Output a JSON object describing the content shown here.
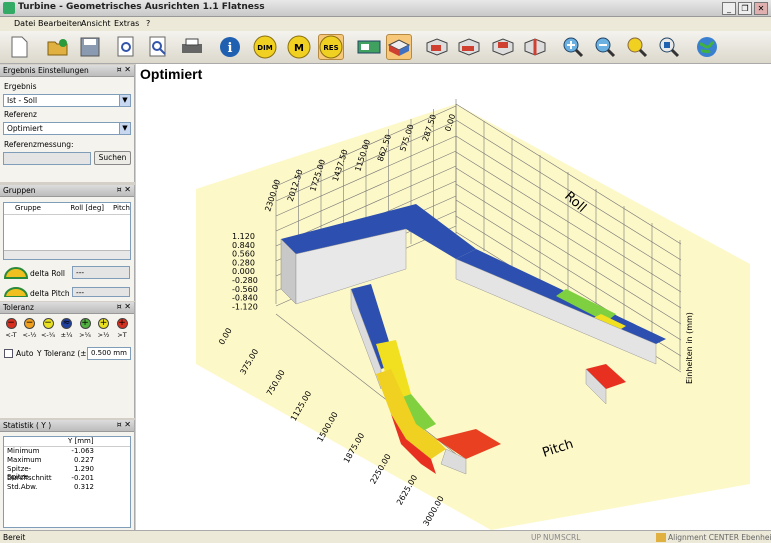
{
  "window": {
    "title": "Turbine - Geometrisches Ausrichten 1.1  Flatness"
  },
  "menu": [
    "Datei",
    "Bearbeiten",
    "Ansicht",
    "Extras",
    "?"
  ],
  "toolbar": {
    "buttons": [
      {
        "name": "new-document-icon",
        "label": ""
      },
      {
        "name": "open-folder-icon",
        "label": ""
      },
      {
        "name": "save-icon",
        "label": ""
      },
      {
        "name": "print-preview-icon",
        "label": ""
      },
      {
        "name": "search-document-icon",
        "label": ""
      },
      {
        "name": "printer-icon",
        "label": ""
      },
      {
        "name": "info-icon",
        "label": ""
      },
      {
        "name": "dim-icon",
        "label": "DIM"
      },
      {
        "name": "measure-m-icon",
        "label": "M"
      },
      {
        "name": "res-icon",
        "label": "RES"
      },
      {
        "name": "device-icon",
        "label": ""
      },
      {
        "name": "view-3d-icon",
        "label": ""
      },
      {
        "name": "view-front-icon",
        "label": ""
      },
      {
        "name": "view-side-icon",
        "label": ""
      },
      {
        "name": "view-top-icon",
        "label": ""
      },
      {
        "name": "view-iso-icon",
        "label": ""
      },
      {
        "name": "zoom-in-icon",
        "label": ""
      },
      {
        "name": "zoom-out-icon",
        "label": ""
      },
      {
        "name": "zoom-fit-icon",
        "label": ""
      },
      {
        "name": "zoom-select-icon",
        "label": ""
      },
      {
        "name": "globe-icon",
        "label": ""
      }
    ]
  },
  "ergebnis": {
    "header": "Ergebnis Einstellungen",
    "ergebnis_label": "Ergebnis",
    "ergebnis_value": "Ist - Soll",
    "referenz_label": "Referenz",
    "referenz_value": "Optimiert",
    "referenzmessung_label": "Referenzmessung:",
    "suchen": "Suchen"
  },
  "gruppen": {
    "header": "Gruppen",
    "columns": [
      "Gruppe",
      "Roll [deg]",
      "Pitch"
    ],
    "delta_roll_label": "delta Roll",
    "delta_roll_value": "---",
    "delta_pitch_label": "delta Pitch",
    "delta_pitch_value": "---"
  },
  "toleranz": {
    "header": "Toleranz",
    "items": [
      {
        "symbol": "−",
        "label": "<-T",
        "color": "#d83020"
      },
      {
        "symbol": "−",
        "label": "<-½",
        "color": "#f0a020"
      },
      {
        "symbol": "−",
        "label": "<-¼",
        "color": "#e8e020"
      },
      {
        "symbol": "≈",
        "label": "±¼",
        "color": "#2040a0"
      },
      {
        "symbol": "+",
        "label": ">¼",
        "color": "#50b040"
      },
      {
        "symbol": "+",
        "label": ">½",
        "color": "#e8e020"
      },
      {
        "symbol": "+",
        "label": ">T",
        "color": "#d83020"
      }
    ],
    "auto_label": "Auto",
    "y_tol_label": "Y Toleranz (±)",
    "y_tol_value": "0.500 mm"
  },
  "statistik": {
    "header": "Statistik ( Y )",
    "col": "Y [mm]",
    "rows": [
      {
        "k": "Minimum",
        "v": "-1.063"
      },
      {
        "k": "Maximum",
        "v": "0.227"
      },
      {
        "k": "Spitze-Spitze",
        "v": "1.290"
      },
      {
        "k": "Durchschnitt",
        "v": "-0.201"
      },
      {
        "k": "Std.Abw.",
        "v": "0.312"
      }
    ]
  },
  "view": {
    "title": "Optimiert",
    "roll_label": "Roll",
    "pitch_label": "Pitch",
    "y_unit_label": "Einheiten in (mm)",
    "roll_ticks": [
      "2300.00",
      "2012.50",
      "1725.00",
      "1437.50",
      "1150.00",
      "862.50",
      "575.00",
      "287.50",
      "0.00"
    ],
    "pitch_ticks": [
      "0.00",
      "375.00",
      "750.00",
      "1125.00",
      "1500.00",
      "1875.00",
      "2250.00",
      "2625.00",
      "3000.00"
    ],
    "y_ticks": [
      "1.120",
      "0.840",
      "0.560",
      "0.280",
      "0.000",
      "-0.280",
      "-0.560",
      "-0.840",
      "-1.120"
    ]
  },
  "status": {
    "left": "Bereit",
    "ind1": "UP",
    "ind2": "NUM",
    "ind3": "SCRL",
    "right": "Alignment CENTER Ebenheit Da"
  }
}
